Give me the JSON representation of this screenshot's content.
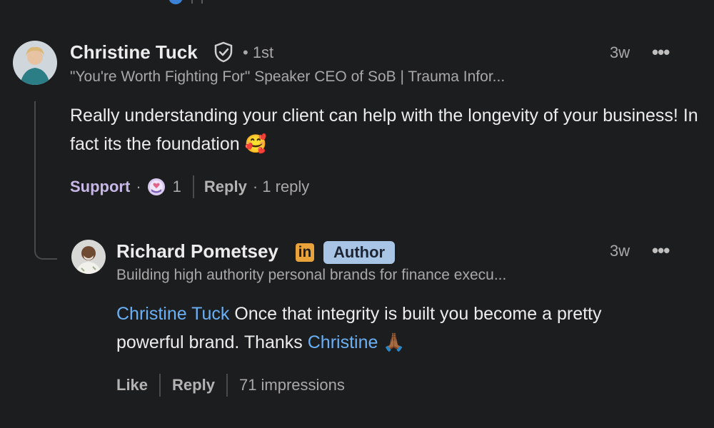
{
  "comment": {
    "author": "Christine Tuck",
    "connection": "• 1st",
    "time": "3w",
    "more": "•••",
    "headline": "\"You're Worth Fighting For\" Speaker CEO of SoB | Trauma Infor...",
    "text": "Really understanding your client can help with the longevity of your business! In fact its the foundation",
    "emoji": "🥰",
    "actions": {
      "support_label": "Support",
      "dot": "·",
      "reaction_count": "1",
      "reply_label": "Reply",
      "reply_count": "· 1 reply"
    }
  },
  "reply": {
    "author": "Richard Pometsey",
    "linkedin_badge": "in",
    "author_badge": "Author",
    "time": "3w",
    "more": "•••",
    "headline": "Building high authority personal brands for finance execu...",
    "mention": "Christine Tuck",
    "text_part1": " Once that integrity is built you become a pretty powerful brand. Thanks ",
    "mention2": "Christine",
    "emoji": "🙏🏾",
    "actions": {
      "like_label": "Like",
      "reply_label": "Reply",
      "impressions": "71 impressions"
    }
  },
  "colors": {
    "background": "#1c1d1f",
    "mention": "#6ab0f5",
    "author_badge_bg": "#a9c5e6",
    "linkedin_badge_bg": "#e8a33b"
  },
  "icons": [
    "verified-shield-icon",
    "support-reaction-icon",
    "more-options-icon",
    "linkedin-icon",
    "avatar-christine",
    "avatar-richard"
  ]
}
